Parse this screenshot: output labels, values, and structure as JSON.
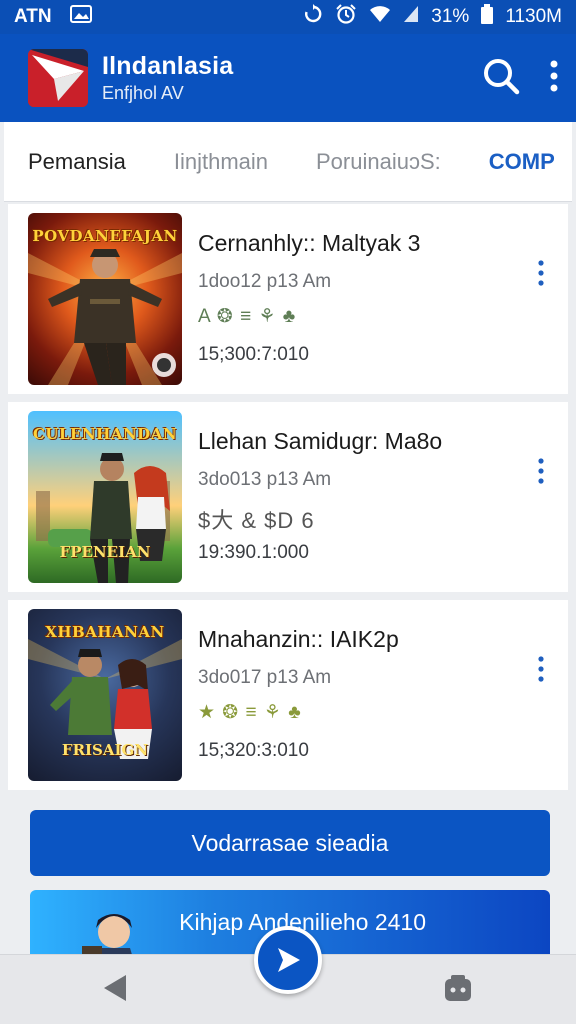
{
  "status_bar": {
    "left_label": "ATN",
    "battery": "31%",
    "time": "1130M"
  },
  "app_bar": {
    "title": "Ilndanlasia",
    "subtitle": "Enfjhol AV",
    "icons": [
      "search-icon",
      "more-vert-icon"
    ]
  },
  "tabs": [
    {
      "label": "Pemansia",
      "active": true
    },
    {
      "label": "Iinjthmain",
      "active": false
    },
    {
      "label": "PoruinaiuɔS:",
      "active": false
    },
    {
      "label": "COMP",
      "active": false
    }
  ],
  "items": [
    {
      "thumb_title": "POVDANEFAJAN",
      "thumb_footer": "",
      "title": "Cernanhly:: Maltyak 3",
      "date": "1doo12 p13 Am",
      "tags": "A ❂ ≡ ⚘ ♣",
      "number": "15;300:7:010"
    },
    {
      "thumb_title": "CULENHANDAN",
      "thumb_footer": "FPENEIAN",
      "title": "Llehan Samidugr: Ma8o",
      "date": "3do013 p13 Am",
      "tags": "$大 & $D 6",
      "number": "19:390.1:000"
    },
    {
      "thumb_title": "XHBAHANAN",
      "thumb_footer": "FRISAIGN",
      "title": "Mnahanzin:: IAIK2p",
      "date": "3do017 p13 Am",
      "tags": "★ ❂ ≡ ⚘ ♣",
      "number": "15;320:3:010"
    }
  ],
  "primary_button": "Vodarrasae sieadia",
  "banner": "Kihjap Andenilieho 2410",
  "colors": {
    "primary": "#0a52bf",
    "accent_tab": "#1b5fc4",
    "logo_red": "#c9202a"
  }
}
